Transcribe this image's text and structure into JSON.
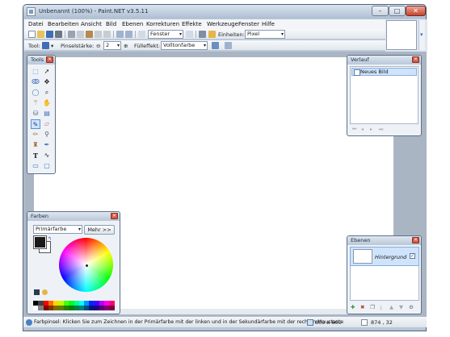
{
  "window": {
    "title": "Unbenannt (100%) - Paint.NET v3.5.11",
    "minimize": "–",
    "maximize": "□",
    "close": "✕"
  },
  "menu": {
    "items": [
      "Datei",
      "Bearbeiten",
      "Ansicht",
      "Bild",
      "Ebenen",
      "Korrekturen",
      "Effekte",
      "Werkzeuge",
      "Fenster",
      "Hilfe"
    ]
  },
  "toolbar1": {
    "window_combo": "Fenster",
    "units_label": "Einheiten:",
    "units_value": "Pixel"
  },
  "toolbar2": {
    "tool_label": "Tool:",
    "brush_width_label": "Pinselstärke:",
    "brush_width_value": "2",
    "fill_label": "Fülleffekt:",
    "fill_value": "Vollton­farbe"
  },
  "tools_panel": {
    "title": "Tools",
    "close": "✕",
    "tools": [
      "rectangle-select",
      "move-selection",
      "lasso",
      "move-selected",
      "ellipse-select",
      "zoom",
      "magic-wand",
      "pan",
      "paint-bucket",
      "gradient",
      "paintbrush",
      "eraser",
      "pencil",
      "color-picker",
      "clone-stamp",
      "recolor",
      "text",
      "line-curve",
      "rectangle",
      "rounded-rectangle",
      "ellipse",
      "freeform-shape"
    ]
  },
  "history_panel": {
    "title": "Verlauf",
    "close": "✕",
    "items": [
      "Neues Bild"
    ]
  },
  "colors_panel": {
    "title": "Farben",
    "close": "✕",
    "mode_select": "Primärfarbe",
    "more_button": "Mehr >>",
    "primary_color": "#1a1a1a",
    "secondary_color": "#ffffff",
    "palette": [
      "#000000",
      "#404040",
      "#ff0000",
      "#ff6a00",
      "#ffd800",
      "#b6ff00",
      "#4cff00",
      "#00ff21",
      "#00ff90",
      "#00ffff",
      "#0094ff",
      "#0026ff",
      "#4800ff",
      "#b200ff",
      "#ff00dc",
      "#ff006e",
      "#ffffff",
      "#808080",
      "#7f0000",
      "#7f3300",
      "#7f6a00",
      "#5b7f00",
      "#267f00",
      "#007f0e",
      "#007f46",
      "#007f7f",
      "#004a7f",
      "#00137f",
      "#21007f",
      "#57007f",
      "#7f006e",
      "#7f0037"
    ]
  },
  "layers_panel": {
    "title": "Ebenen",
    "close": "✕",
    "layers": [
      {
        "name": "Hintergrund",
        "visible": true
      }
    ]
  },
  "status": {
    "message": "Farbpinsel: Klicken Sie zum Zeichnen in der Primärfarbe mit der linken und in der Sekundärfarbe mit der rechten Maustaste",
    "image_size": "800 x 600",
    "cursor_position": "874 , 32"
  }
}
